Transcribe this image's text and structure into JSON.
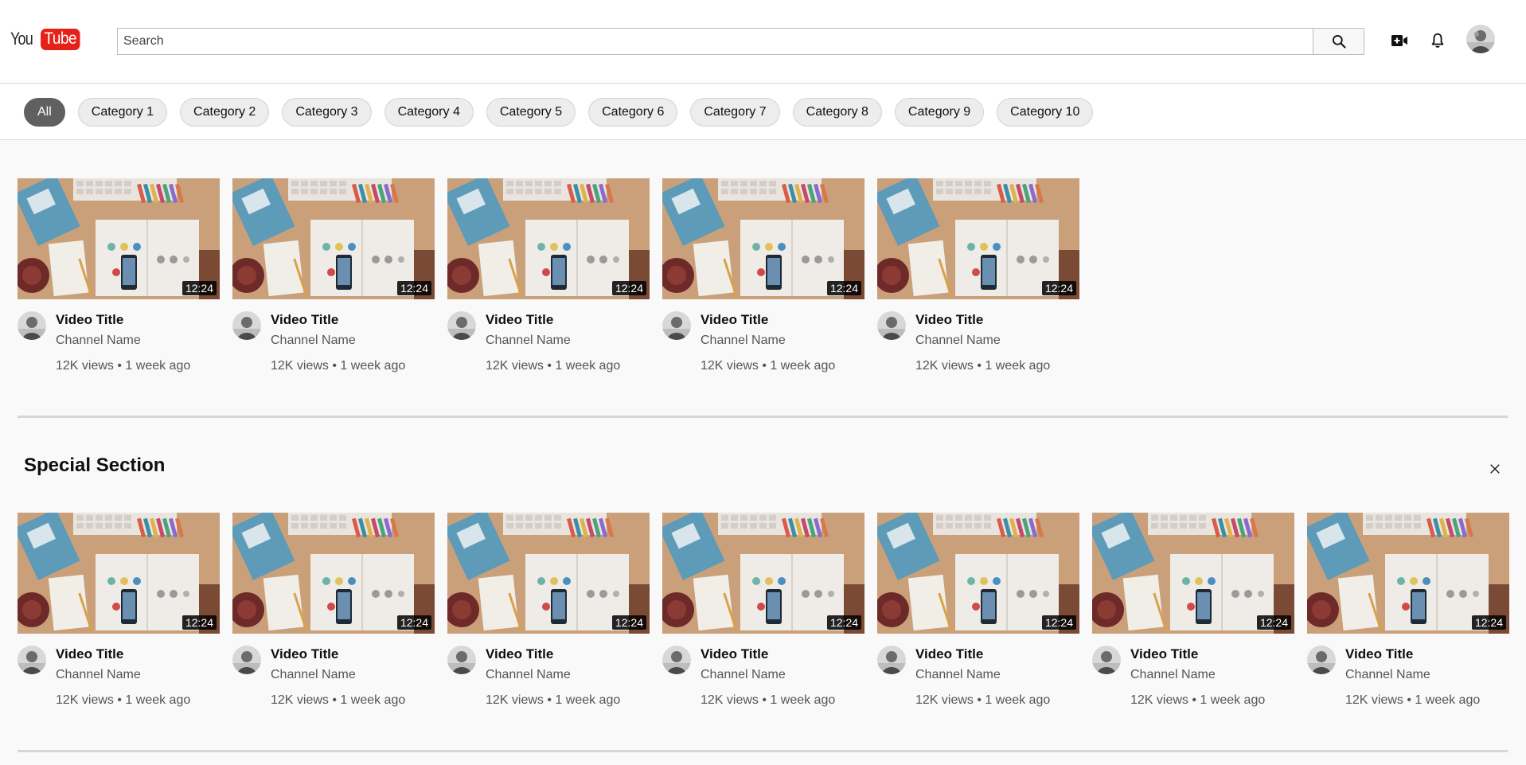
{
  "header": {
    "logo_you": "You",
    "logo_tube": "Tube",
    "search": {
      "placeholder": "Search",
      "value": ""
    },
    "icons": [
      "search-icon",
      "create-video-icon",
      "bell-icon",
      "avatar"
    ]
  },
  "chips": [
    "All",
    "Category 1",
    "Category 2",
    "Category 3",
    "Category 4",
    "Category 5",
    "Category 6",
    "Category 7",
    "Category 8",
    "Category 9",
    "Category 10"
  ],
  "active_chip": "All",
  "main_section": {
    "videos": [
      {
        "title": "Video Title",
        "channel": "Channel Name",
        "stats": "12K views • 1 week ago",
        "duration": "12:24"
      },
      {
        "title": "Video Title",
        "channel": "Channel Name",
        "stats": "12K views • 1 week ago",
        "duration": "12:24"
      },
      {
        "title": "Video Title",
        "channel": "Channel Name",
        "stats": "12K views • 1 week ago",
        "duration": "12:24"
      },
      {
        "title": "Video Title",
        "channel": "Channel Name",
        "stats": "12K views • 1 week ago",
        "duration": "12:24"
      },
      {
        "title": "Video Title",
        "channel": "Channel Name",
        "stats": "12K views • 1 week ago",
        "duration": "12:24"
      }
    ]
  },
  "special_section": {
    "title": "Special Section",
    "videos": [
      {
        "title": "Video Title",
        "channel": "Channel Name",
        "stats": "12K views • 1 week ago",
        "duration": "12:24"
      },
      {
        "title": "Video Title",
        "channel": "Channel Name",
        "stats": "12K views • 1 week ago",
        "duration": "12:24"
      },
      {
        "title": "Video Title",
        "channel": "Channel Name",
        "stats": "12K views • 1 week ago",
        "duration": "12:24"
      },
      {
        "title": "Video Title",
        "channel": "Channel Name",
        "stats": "12K views • 1 week ago",
        "duration": "12:24"
      },
      {
        "title": "Video Title",
        "channel": "Channel Name",
        "stats": "12K views • 1 week ago",
        "duration": "12:24"
      },
      {
        "title": "Video Title",
        "channel": "Channel Name",
        "stats": "12K views • 1 week ago",
        "duration": "12:24"
      },
      {
        "title": "Video Title",
        "channel": "Channel Name",
        "stats": "12K views • 1 week ago",
        "duration": "12:24"
      }
    ]
  },
  "colors": {
    "brand_red": "#e62117",
    "chip_active": "#606060",
    "background": "#f9f9f9"
  }
}
